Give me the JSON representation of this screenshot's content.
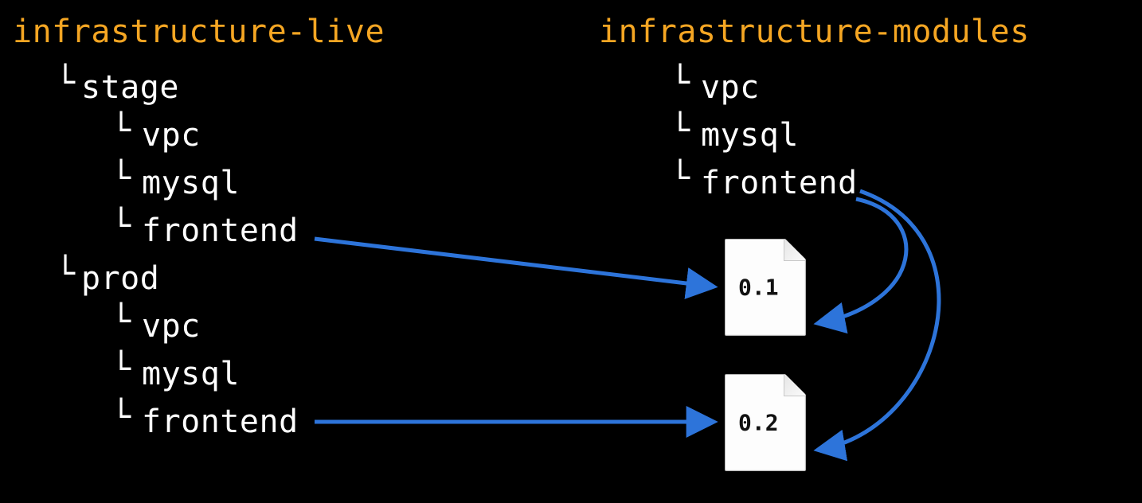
{
  "left": {
    "title": "infrastructure-live",
    "stage": {
      "label": "stage",
      "items": [
        "vpc",
        "mysql",
        "frontend"
      ]
    },
    "prod": {
      "label": "prod",
      "items": [
        "vpc",
        "mysql",
        "frontend"
      ]
    }
  },
  "right": {
    "title": "infrastructure-modules",
    "items": [
      "vpc",
      "mysql",
      "frontend"
    ]
  },
  "files": {
    "v1": "0.1",
    "v2": "0.2"
  },
  "glyph": "└",
  "colors": {
    "amber": "#f5a623",
    "arrow": "#2d74da"
  }
}
